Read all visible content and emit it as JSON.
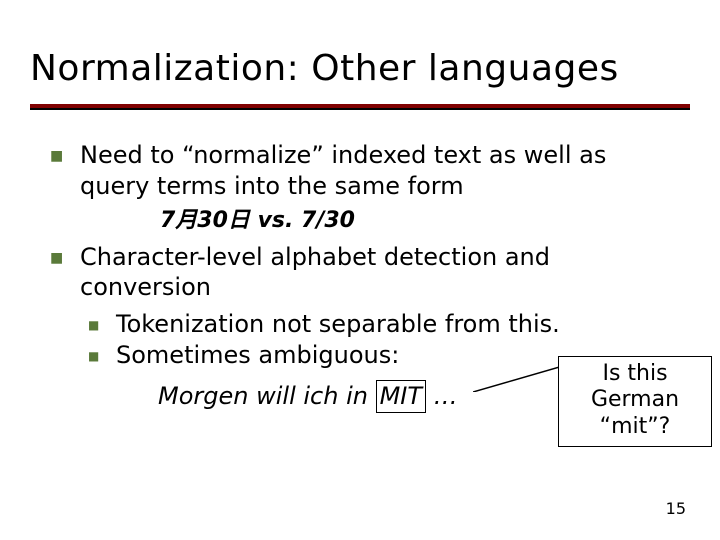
{
  "title": "Normalization: Other languages",
  "bullets": {
    "b1": "Need to “normalize” indexed text as well as query terms into the same form",
    "example1": "7月30日 vs. 7/30",
    "b2": "Character-level alphabet detection and conversion",
    "b2_sub1": "Tokenization not separable from this.",
    "b2_sub2": "Sometimes ambiguous:",
    "example2_prefix": "Morgen will ich in ",
    "example2_box": "MIT",
    "example2_suffix": " …"
  },
  "callout": {
    "line1": "Is this",
    "line2": "German “mit”?"
  },
  "page_number": "15"
}
